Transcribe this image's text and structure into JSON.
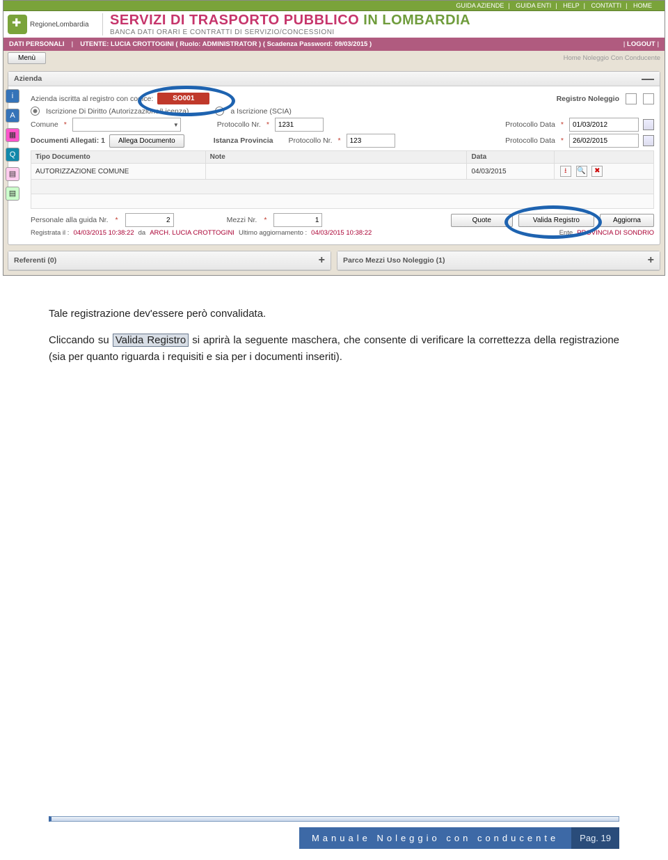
{
  "topnav": {
    "items": [
      "GUIDA AZIENDE",
      "GUIDA ENTI",
      "HELP",
      "CONTATTI",
      "HOME"
    ]
  },
  "brand": {
    "region": "RegioneLombardia",
    "title_a": "SERVIZI DI TRASPORTO PUBBLICO",
    "title_b": " IN LOMBARDIA",
    "subtitle": "BANCA DATI ORARI E CONTRATTI DI SERVIZIO/CONCESSIONI"
  },
  "userbar": {
    "dati": "DATI PERSONALI",
    "utente": "UTENTE:  LUCIA CROTTOGINI  ( Ruolo: ADMINISTRATOR )  ( Scadenza Password: 09/03/2015 )",
    "logout": "LOGOUT"
  },
  "menu": {
    "menu": "Menù",
    "crumb": "Home Noleggio Con Conducente"
  },
  "panel": {
    "title": "Azienda",
    "codice_lbl": "Azienda iscritta al registro con codice:",
    "codice_val": "SO001",
    "reg_nol": "Registro Noleggio",
    "opt1": "Iscrizione Di Diritto (Autorizzazione/Licenza)",
    "opt2": "a Iscrizione (SCIA)",
    "comune": "Comune",
    "protn": "Protocollo Nr.",
    "protn_v1": "1231",
    "protd": "Protocollo Data",
    "protd_v1": "01/03/2012",
    "docall": "Documenti Allegati: 1",
    "allega": "Allega Documento",
    "istprov": "Istanza Provincia",
    "protn_v2": "123",
    "protd_v2": "26/02/2015",
    "th1": "Tipo Documento",
    "th2": "Note",
    "th3": "Data",
    "td1": "AUTORIZZAZIONE COMUNE",
    "td3": "04/03/2015",
    "pers": "Personale alla guida Nr.",
    "pers_v": "2",
    "mezzi": "Mezzi Nr.",
    "mezzi_v": "1",
    "quote": "Quote",
    "valida": "Valida Registro",
    "aggiorna": "Aggiorna",
    "regil": "Registrata il :",
    "regil_v": "04/03/2015 10:38:22",
    "da": "da",
    "arch": "ARCH. LUCIA CROTTOGINI",
    "ultagg": "Ultimo aggiornamento :",
    "ultagg_v": "04/03/2015 10:38:22",
    "ente": "Ente",
    "prov": "PROVINCIA DI SONDRIO",
    "sub1": "Referenti (0)",
    "sub2": "Parco Mezzi Uso Noleggio (1)"
  },
  "doc": {
    "p1": "Tale registrazione dev'essere però convalidata.",
    "p2a": "Cliccando su ",
    "p2hl": "Valida Registro",
    "p2b": " si aprirà la seguente maschera, che consente di verificare la correttezza della registrazione (sia per quanto riguarda i requisiti e sia per i documenti inseriti)."
  },
  "footer": {
    "title": "Manuale Noleggio con conducente",
    "page": "Pag. 19"
  }
}
